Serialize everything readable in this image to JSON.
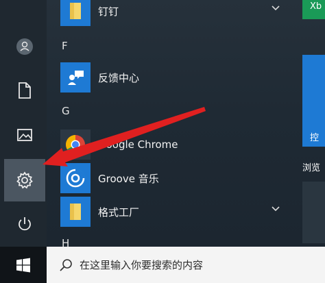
{
  "app_list": {
    "items": [
      {
        "label": "钉钉"
      },
      {
        "label": "反馈中心"
      },
      {
        "label": "Google Chrome"
      },
      {
        "label": "Groove 音乐"
      },
      {
        "label": "格式工厂"
      }
    ],
    "letters": [
      "F",
      "G",
      "H"
    ]
  },
  "tiles": {
    "top_right_label": "Xb",
    "blue_label": "控",
    "browse_label": "浏览"
  },
  "taskbar": {
    "search_placeholder": "在这里输入你要搜索的内容"
  },
  "colors": {
    "accent_blue": "#1e7ad4",
    "tile_green": "#1a9a57",
    "annotation_red": "#e02020"
  }
}
